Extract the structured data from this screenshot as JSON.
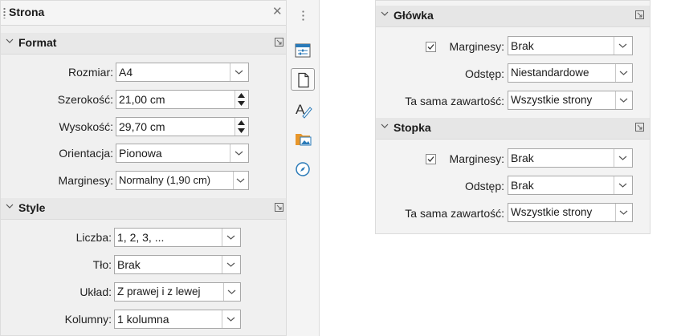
{
  "left_panel": {
    "title": "Strona",
    "format": {
      "header": "Format",
      "size_label": "Rozmiar:",
      "size_value": "A4",
      "width_label": "Szerokość:",
      "width_value": "21,00 cm",
      "height_label": "Wysokość:",
      "height_value": "29,70 cm",
      "orientation_label": "Orientacja:",
      "orientation_value": "Pionowa",
      "margins_label": "Marginesy:",
      "margins_value": "Normalny (1,90 cm)"
    },
    "style": {
      "header": "Style",
      "number_label": "Liczba:",
      "number_value": "1, 2, 3, ...",
      "background_label": "Tło:",
      "background_value": "Brak",
      "layout_label": "Układ:",
      "layout_value": "Z prawej i z lewej",
      "columns_label": "Kolumny:",
      "columns_value": "1 kolumna"
    }
  },
  "tab_bar": {
    "tabs": [
      {
        "icon": "properties-icon"
      },
      {
        "icon": "page-icon",
        "active": true
      },
      {
        "icon": "styles-icon"
      },
      {
        "icon": "gallery-icon"
      },
      {
        "icon": "navigator-icon"
      }
    ]
  },
  "right_panel": {
    "header_section": {
      "header": "Główka",
      "margins_label": "Marginesy:",
      "margins_checked": true,
      "margins_value": "Brak",
      "spacing_label": "Odstęp:",
      "spacing_value": "Niestandardowe",
      "same_content_label": "Ta sama zawartość:",
      "same_content_value": "Wszystkie strony"
    },
    "footer_section": {
      "header": "Stopka",
      "margins_label": "Marginesy:",
      "margins_checked": true,
      "margins_value": "Brak",
      "spacing_label": "Odstęp:",
      "spacing_value": "Brak",
      "same_content_label": "Ta sama zawartość:",
      "same_content_value": "Wszystkie strony"
    }
  },
  "colors": {
    "panel_bg": "#f0f0f0",
    "header_bg": "#e8e8e8",
    "field_border": "#a8a8a8",
    "accent": "#2a7ab8",
    "folder": "#e8962a"
  }
}
